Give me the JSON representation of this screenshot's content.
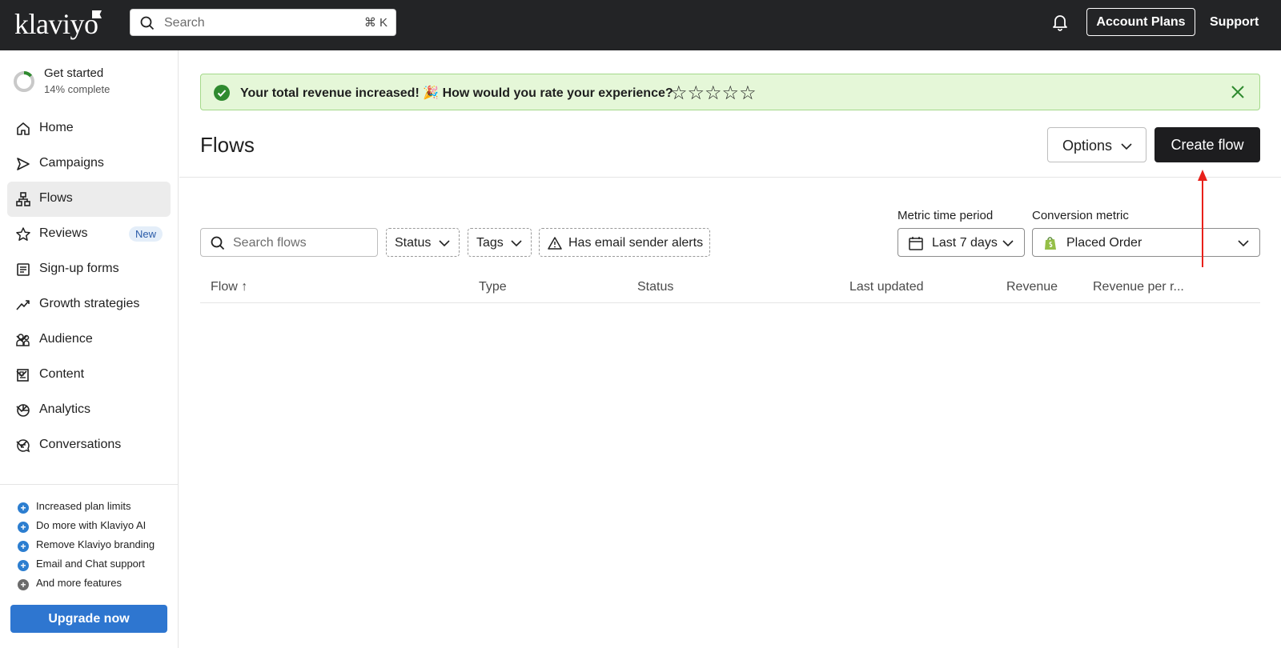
{
  "topbar": {
    "logo": "klaviyo",
    "search_placeholder": "Search",
    "search_shortcut": "⌘ K",
    "account_plans": "Account Plans",
    "support": "Support"
  },
  "sidebar": {
    "get_started": {
      "title": "Get started",
      "progress_text": "14% complete",
      "progress": 0.14
    },
    "items": [
      {
        "label": "Home",
        "icon": "home-icon"
      },
      {
        "label": "Campaigns",
        "icon": "send-icon"
      },
      {
        "label": "Flows",
        "icon": "flows-icon",
        "active": true
      },
      {
        "label": "Reviews",
        "icon": "star-icon",
        "badge": "New"
      },
      {
        "label": "Sign-up forms",
        "icon": "form-icon"
      },
      {
        "label": "Growth strategies",
        "icon": "trend-icon"
      },
      {
        "label": "Audience",
        "icon": "people-icon",
        "expandable": true
      },
      {
        "label": "Content",
        "icon": "content-icon",
        "expandable": true
      },
      {
        "label": "Analytics",
        "icon": "pie-icon",
        "expandable": true
      },
      {
        "label": "Conversations",
        "icon": "chat-icon",
        "expandable": true
      }
    ],
    "features": [
      "Increased plan limits",
      "Do more with Klaviyo AI",
      "Remove Klaviyo branding",
      "Email and Chat support",
      "And more features"
    ],
    "upgrade_button": "Upgrade now"
  },
  "banner": {
    "message": "Your total revenue increased! 🎉 How would you rate your experience?",
    "stars": "☆☆☆☆☆",
    "rating_max": 5
  },
  "page": {
    "title": "Flows",
    "options_button": "Options",
    "create_button": "Create flow"
  },
  "filters": {
    "search_placeholder": "Search flows",
    "status": "Status",
    "tags": "Tags",
    "alerts": "Has email sender alerts",
    "metric_time_label": "Metric time period",
    "metric_time_value": "Last 7 days",
    "conversion_label": "Conversion metric",
    "conversion_value": "Placed Order"
  },
  "table": {
    "columns": [
      "Flow ↑",
      "Type",
      "Status",
      "Last updated",
      "Revenue",
      "Revenue per r..."
    ]
  },
  "colors": {
    "topbar": "#232426",
    "banner_bg": "#e5f7d8",
    "upgrade": "#2e76d0",
    "annotation_arrow": "#e8201a"
  }
}
